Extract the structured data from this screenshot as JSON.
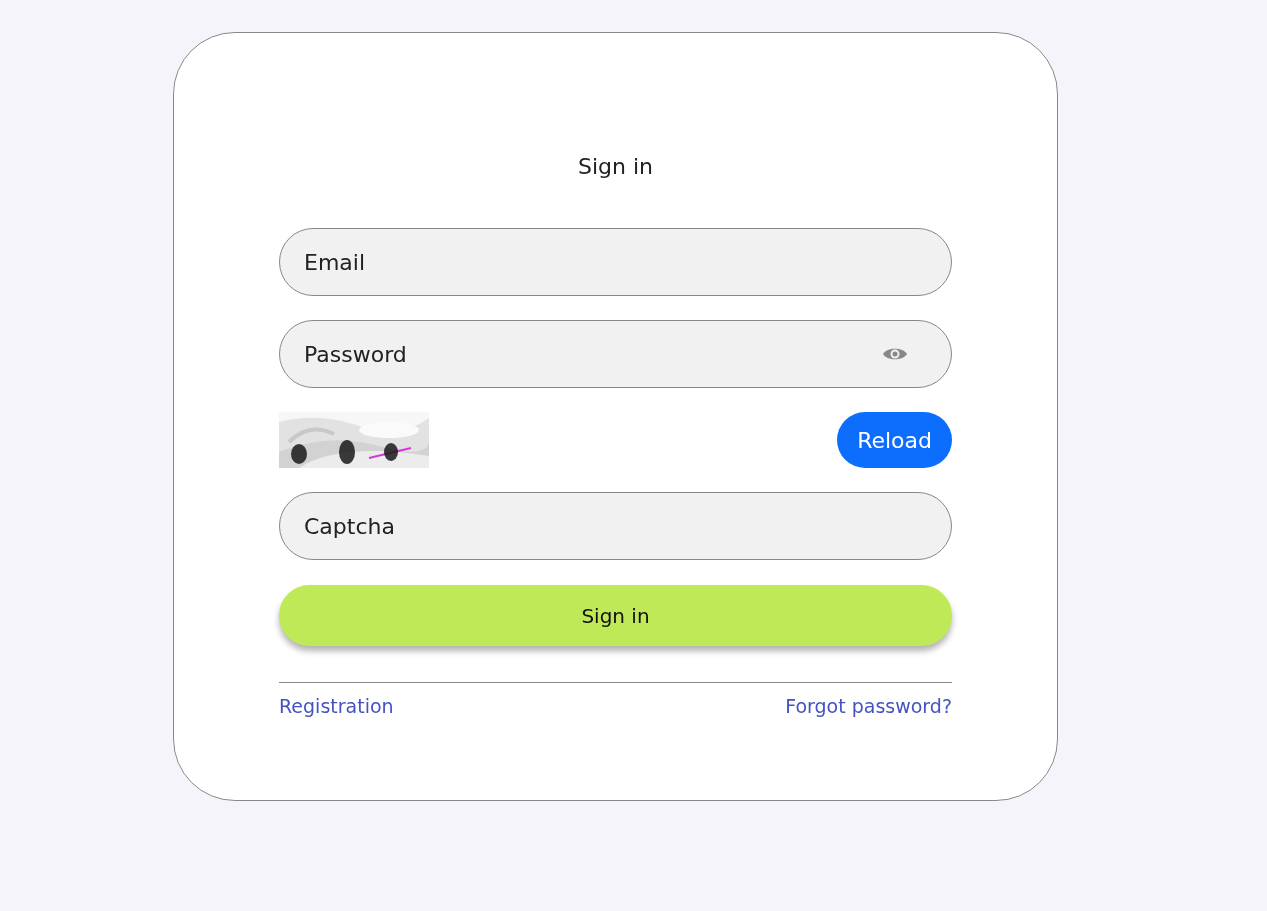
{
  "title": "Sign in",
  "fields": [
    {
      "kind": "text",
      "placeholder": "Email"
    },
    {
      "kind": "password",
      "placeholder": "Password"
    }
  ],
  "captcha": {
    "reload_button": "Reload",
    "field": {
      "placeholder": "Captcha"
    }
  },
  "submit_button": "Sign in",
  "links": [
    "Registration",
    "Forgot password?"
  ]
}
